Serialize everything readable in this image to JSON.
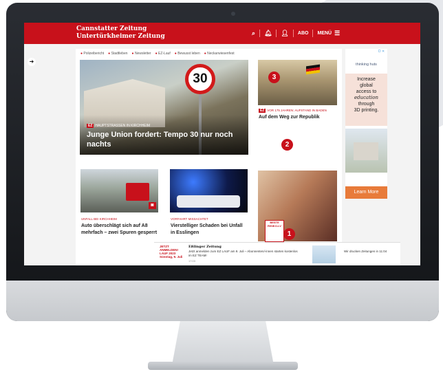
{
  "site": {
    "logo_line1": "Cannstatter Zeitung",
    "logo_line2": "Untertürkheimer Zeitung"
  },
  "nav": {
    "abo": "ABO",
    "menu": "MENÜ"
  },
  "tags": [
    "Polizeibericht",
    "Stadtleben",
    "Newsletter",
    "EZ-Lauf",
    "Bewusst leben",
    "Neckarwiesenfest"
  ],
  "hero": {
    "sign_number": "30",
    "ez_badge": "EZ",
    "kicker": "HAUPTSTRASSEN IN KIRCHHEIM",
    "title": "Junge Union fordert: Tempo 30 nur noch nachts"
  },
  "article_right": {
    "ez_badge": "EZ",
    "kicker": "VOR 175 JAHREN: AUFSTAND IN BADEN",
    "title": "Auf dem Weg zur Republik"
  },
  "markers": {
    "one": "1",
    "two": "2",
    "three": "3"
  },
  "card1": {
    "kicker": "UNFALL BEI KIRCHHEIM",
    "title": "Auto überschlägt sich auf A8 mehrfach – zwei Spuren gesperrt"
  },
  "card2": {
    "kicker": "VORFAHRT MISSACHTET",
    "title": "Vierstelliger Schaden bei Unfall in Esslingen"
  },
  "ad_box": {
    "line1": "BESTE",
    "line2": "RISIKO-LV"
  },
  "skyscraper": {
    "adchoice": "D ✕",
    "brand": "thinking huts",
    "line1": "Increase",
    "line2": "global",
    "line3": "access to",
    "line4": "education",
    "line5": "through",
    "line6": "3D printing.",
    "button": "Learn More"
  },
  "banner": {
    "lauf_line1": "JETZT",
    "lauf_line2": "ANMELDEN!",
    "lauf_title": "LAUF 2023",
    "lauf_date": "Sonntag, 9. Juli",
    "brand": "Eßlinger Zeitung",
    "message": "Jetzt anmelden zum EZ LAUF am 9. Juli – Abonnenten/-innen starten kostenlos im EZ TEAM!",
    "time": "17:03",
    "right_text": "Wir drucken Zeitungen in 11:04"
  }
}
